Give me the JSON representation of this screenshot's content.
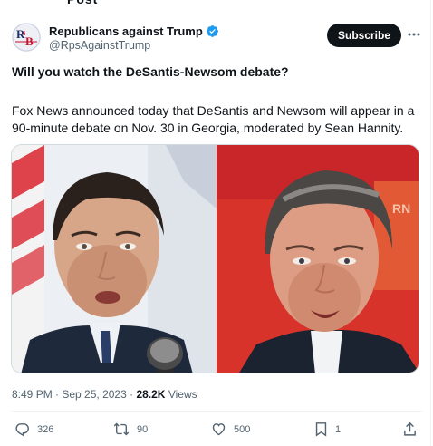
{
  "account": {
    "name": "Republicans against Trump",
    "handle": "@RpsAgainstTrump",
    "avatar_letters": "RsB",
    "subscribe_label": "Subscribe"
  },
  "tweet": {
    "headline": "Will you watch the DeSantis-Newsom debate?",
    "body": "Fox News announced today that DeSantis and Newsom will appear in a 90-minute debate on Nov. 30 in Georgia, moderated by Sean Hannity.",
    "time": "8:49 PM",
    "date": "Sep 25, 2023",
    "views_count": "28.2K",
    "views_label": "Views"
  },
  "stats": {
    "replies": "326",
    "reposts": "90",
    "likes": "500",
    "bookmarks": "1"
  },
  "icons": [
    "verified-badge-icon",
    "more-icon",
    "reply-icon",
    "repost-icon",
    "like-icon",
    "bookmark-icon",
    "share-icon"
  ],
  "colors": {
    "verified": "#1d9bf0",
    "subscribe_bg": "#0f1419",
    "muted": "#536471"
  }
}
